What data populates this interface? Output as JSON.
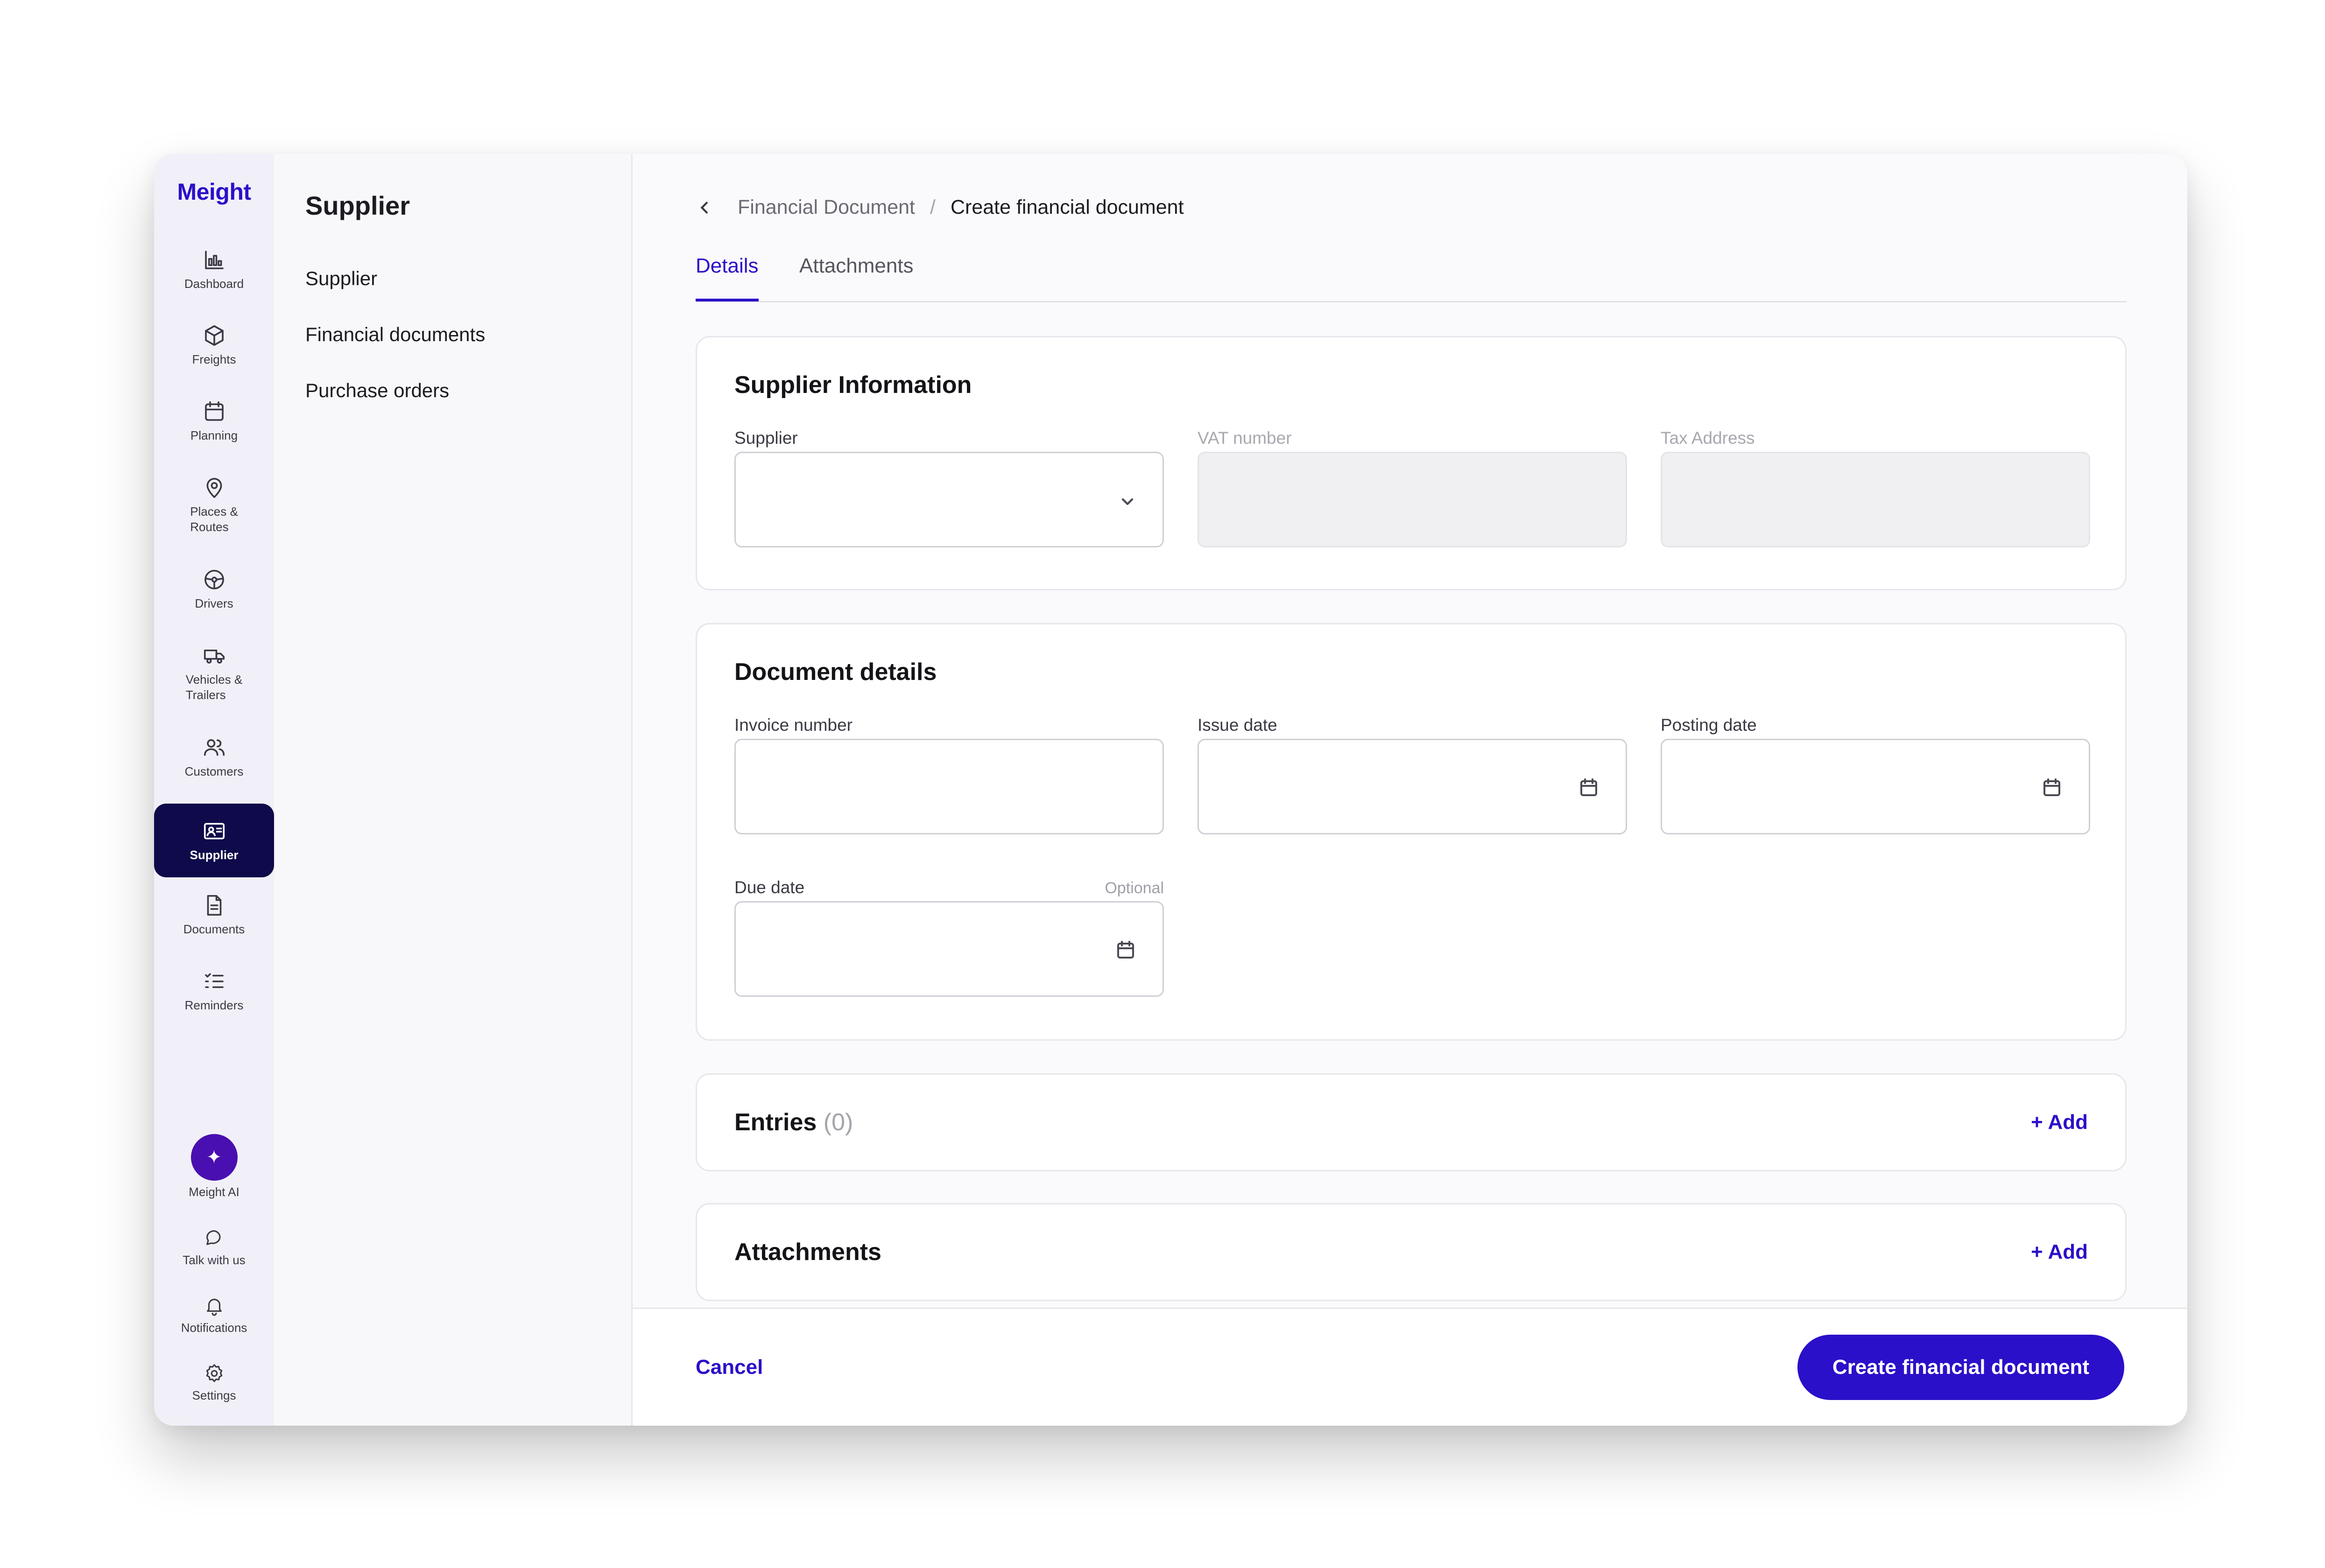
{
  "app": {
    "logo": "Meight"
  },
  "rail": {
    "items": [
      {
        "key": "dashboard",
        "label": "Dashboard",
        "icon": "bar-chart-icon"
      },
      {
        "key": "freights",
        "label": "Freights",
        "icon": "box-icon"
      },
      {
        "key": "planning",
        "label": "Planning",
        "icon": "calendar-icon"
      },
      {
        "key": "places",
        "label": "Places &\nRoutes",
        "icon": "map-pin-icon"
      },
      {
        "key": "drivers",
        "label": "Drivers",
        "icon": "steering-wheel-icon"
      },
      {
        "key": "vehicles",
        "label": "Vehicles &\nTrailers",
        "icon": "truck-icon"
      },
      {
        "key": "customers",
        "label": "Customers",
        "icon": "users-icon"
      },
      {
        "key": "supplier",
        "label": "Supplier",
        "icon": "id-card-icon",
        "active": true
      },
      {
        "key": "documents",
        "label": "Documents",
        "icon": "document-icon"
      },
      {
        "key": "reminders",
        "label": "Reminders",
        "icon": "list-check-icon"
      }
    ],
    "bottom": [
      {
        "key": "meight-ai",
        "label": "Meight AI",
        "icon": "sparkle-icon"
      },
      {
        "key": "talk",
        "label": "Talk with us",
        "icon": "chat-bubble-icon"
      },
      {
        "key": "notifications",
        "label": "Notifications",
        "icon": "bell-icon"
      },
      {
        "key": "settings",
        "label": "Settings",
        "icon": "gear-icon"
      }
    ]
  },
  "subnav": {
    "title": "Supplier",
    "links": [
      "Supplier",
      "Financial documents",
      "Purchase orders"
    ]
  },
  "breadcrumb": {
    "parent": "Financial Document",
    "separator": "/",
    "current": "Create financial document"
  },
  "tabs": [
    "Details",
    "Attachments"
  ],
  "supplier_info": {
    "title": "Supplier Information",
    "supplier_label": "Supplier",
    "vat_label": "VAT number",
    "tax_label": "Tax Address"
  },
  "document_details": {
    "title": "Document details",
    "invoice_label": "Invoice number",
    "issue_label": "Issue date",
    "posting_label": "Posting date",
    "due_label": "Due date",
    "optional": "Optional"
  },
  "entries": {
    "title": "Entries",
    "count": "(0)",
    "add": "+ Add"
  },
  "attachments": {
    "title": "Attachments",
    "add": "+ Add"
  },
  "footer": {
    "cancel": "Cancel",
    "create": "Create financial document"
  },
  "colors": {
    "accent": "#2a10c9",
    "rail_active": "#0f0a4a",
    "ai": "#4a0fb0"
  }
}
